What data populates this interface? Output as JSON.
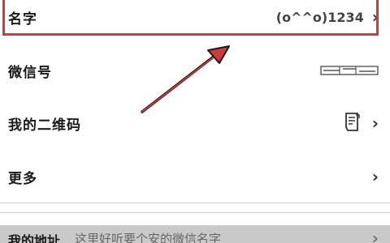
{
  "profile": {
    "name": {
      "label": "名字",
      "value": "(o^^o)1234"
    },
    "wechat_id": {
      "label": "微信号"
    },
    "qr_code": {
      "label": "我的二维码"
    },
    "more": {
      "label": "更多"
    },
    "address": {
      "label": "我的地址",
      "sub": "这里好听要个安的微信名字"
    }
  },
  "icons": {
    "chevron": "›",
    "qr": "qr-code-icon"
  },
  "colors": {
    "highlight": "#d23a3a",
    "address_bg": "#c9c9c9"
  }
}
